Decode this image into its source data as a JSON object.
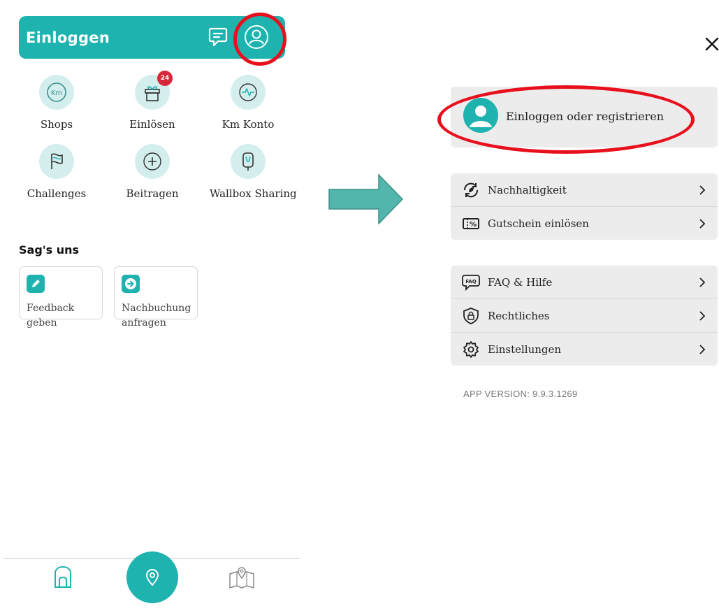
{
  "left": {
    "header": {
      "title": "Einloggen"
    },
    "tiles": [
      {
        "label": "Shops",
        "icon": "km-icon"
      },
      {
        "label": "Einlösen",
        "icon": "gift-icon",
        "badge": "24"
      },
      {
        "label": "Km Konto",
        "icon": "activity-icon"
      },
      {
        "label": "Challenges",
        "icon": "flag-icon"
      },
      {
        "label": "Beitragen",
        "icon": "plus-circle-icon"
      },
      {
        "label": "Wallbox Sharing",
        "icon": "wallbox-icon"
      }
    ],
    "feedback_section": {
      "title": "Sag's uns",
      "cards": [
        {
          "line1": "Feedback",
          "line2": "geben",
          "icon": "pencil-icon"
        },
        {
          "line1": "Nachbuchung",
          "line2": "anfragen",
          "icon": "arrow-right-icon"
        }
      ]
    },
    "bottom_nav": {
      "items": [
        "home-icon",
        "location-pin-icon",
        "map-icon"
      ]
    }
  },
  "right": {
    "login_label": "Einloggen oder registrieren",
    "menu_group_1": [
      {
        "label": "Nachhaltigkeit",
        "icon": "sustainability-icon"
      },
      {
        "label": "Gutschein einlösen",
        "icon": "voucher-icon"
      }
    ],
    "menu_group_2": [
      {
        "label": "FAQ & Hilfe",
        "icon": "faq-icon"
      },
      {
        "label": "Rechtliches",
        "icon": "shield-lock-icon"
      },
      {
        "label": "Einstellungen",
        "icon": "gear-icon"
      }
    ],
    "version": "APP VERSION: 9.9.3.1269"
  },
  "colors": {
    "brand": "#1fb3b0",
    "highlight": "#e8101d",
    "badge": "#d8263a",
    "arrow": "#52b6ad"
  }
}
